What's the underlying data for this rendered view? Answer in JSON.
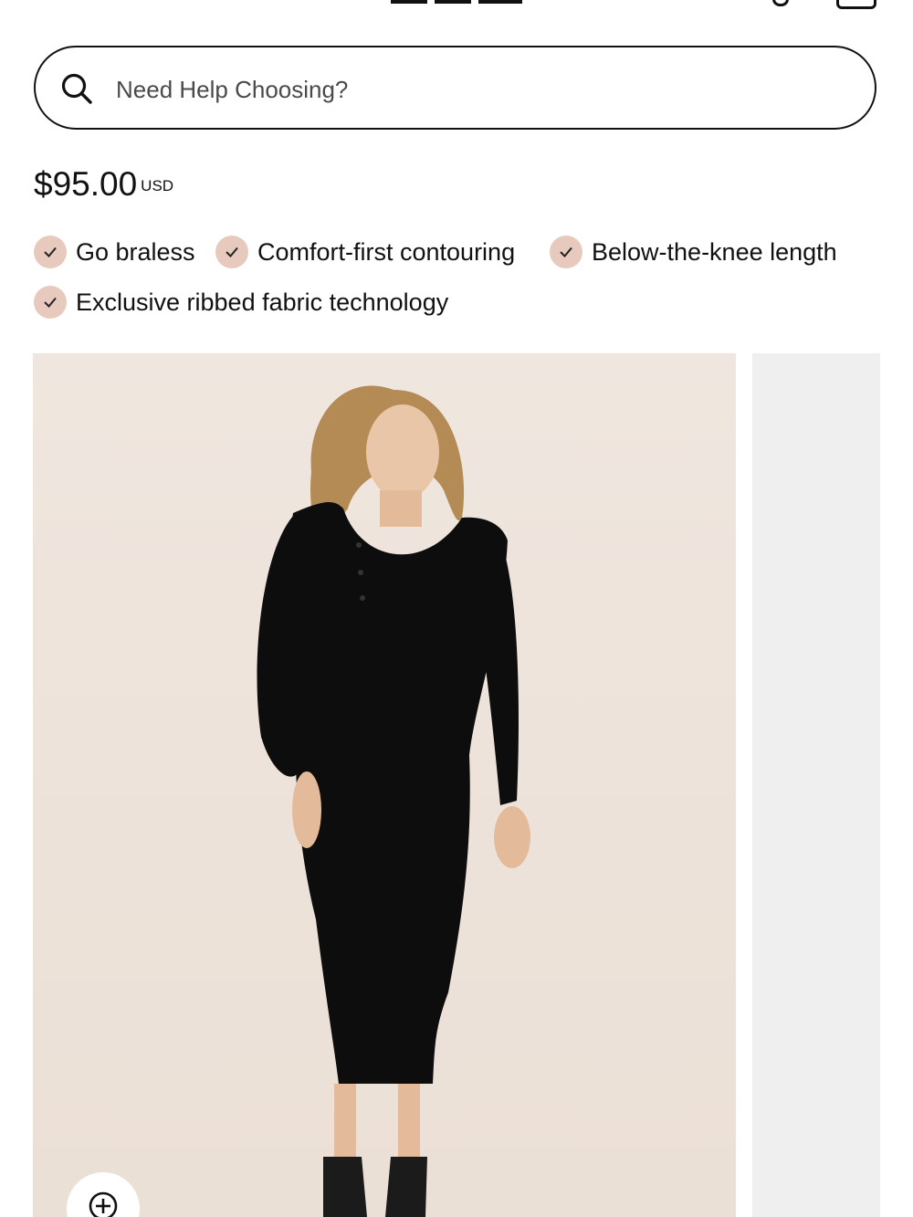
{
  "header": {
    "logo_text": "KITTX"
  },
  "search": {
    "placeholder": "Need Help Choosing?"
  },
  "product": {
    "price": "$95.00",
    "currency": "USD",
    "features": [
      "Go braless",
      "Comfort-first contouring",
      "Below-the-knee length",
      "Exclusive ribbed fabric technology"
    ]
  },
  "gallery": {
    "main_image": "model-in-black-ribbed-henley-midi-dress",
    "zoom_icon": "zoom-in-icon"
  },
  "colors": {
    "check_badge": "#e7c9bd",
    "image_background": "#eee4db",
    "next_image_background": "#efefef",
    "text": "#111111"
  }
}
